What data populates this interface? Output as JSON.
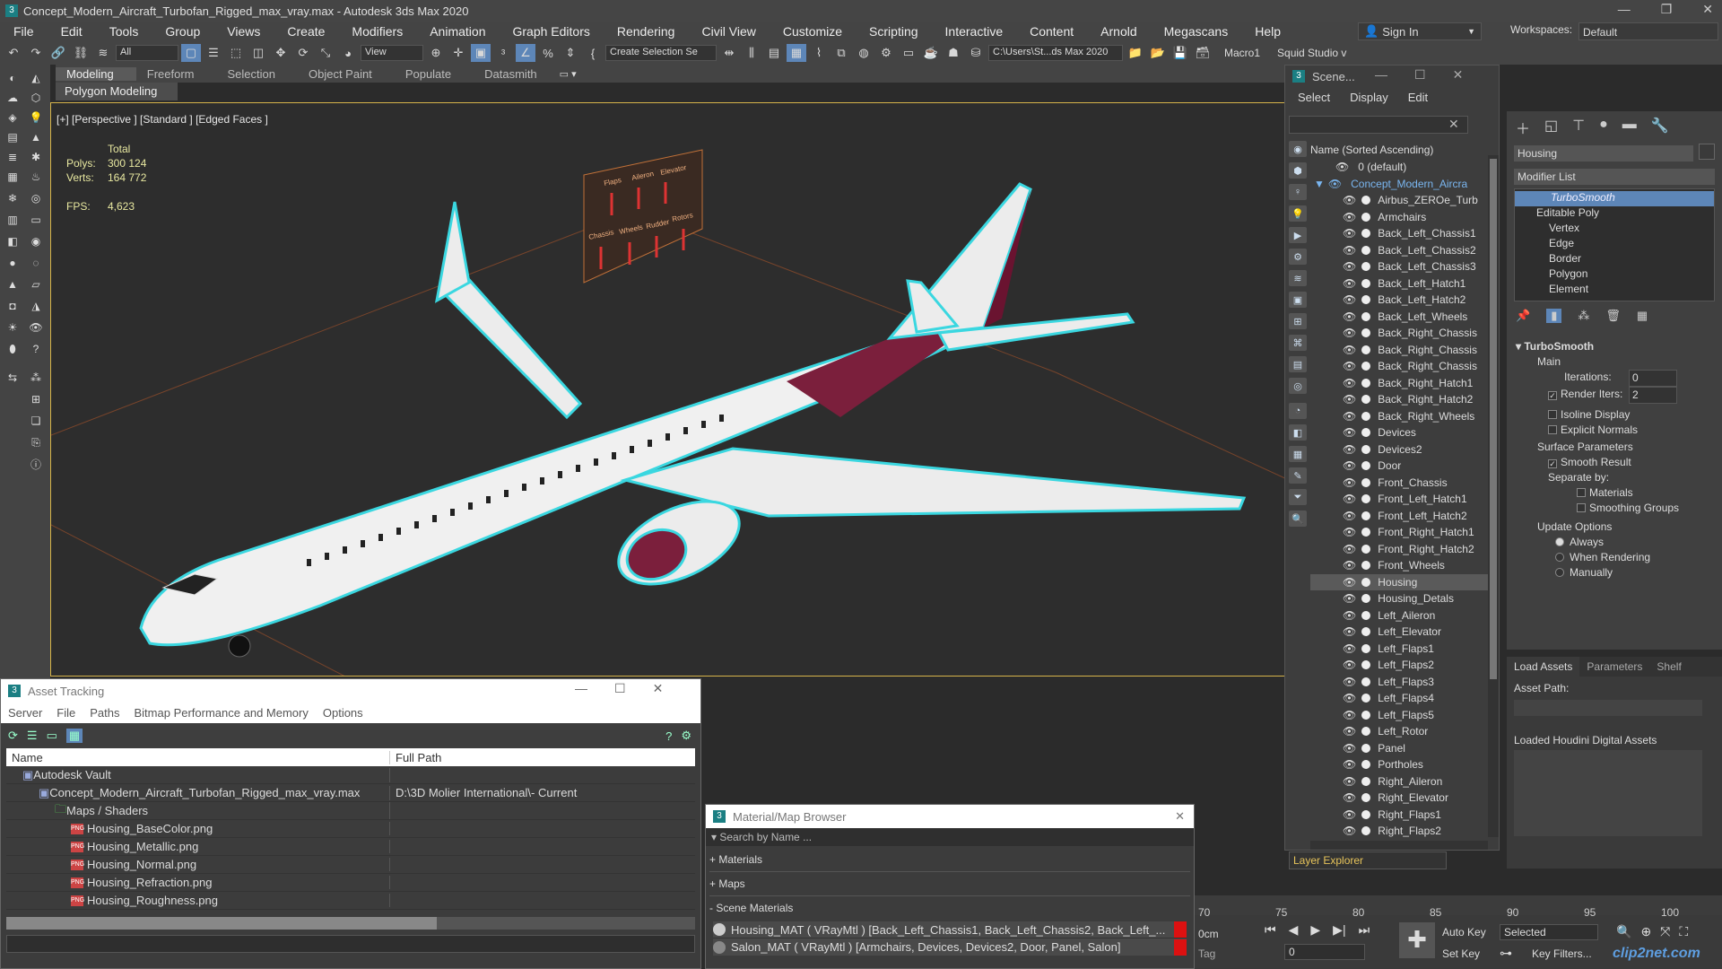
{
  "titlebar": {
    "title": "Concept_Modern_Aircraft_Turbofan_Rigged_max_vray.max - Autodesk 3ds Max 2020"
  },
  "menu": [
    "File",
    "Edit",
    "Tools",
    "Group",
    "Views",
    "Create",
    "Modifiers",
    "Animation",
    "Graph Editors",
    "Rendering",
    "Civil View",
    "Customize",
    "Scripting",
    "Interactive",
    "Content",
    "Arnold",
    "Megascans",
    "Help"
  ],
  "signin": "Sign In",
  "workspaces": {
    "label": "Workspaces:",
    "value": "Default"
  },
  "toolbar": {
    "filter": "All",
    "view": "View",
    "create_selection": "Create Selection Se",
    "path": "C:\\Users\\St...ds Max 2020",
    "macro": "Macro1",
    "squid": "Squid Studio v"
  },
  "ribbon": {
    "tabs": [
      "Modeling",
      "Freeform",
      "Selection",
      "Object Paint",
      "Populate",
      "Datasmith"
    ],
    "sub": "Polygon Modeling"
  },
  "viewport": {
    "label": "[+] [Perspective ] [Standard ] [Edged Faces ]",
    "stats": {
      "header": "Total",
      "polys_label": "Polys:",
      "polys": "300 124",
      "verts_label": "Verts:",
      "verts": "164 772",
      "fps_label": "FPS:",
      "fps": "4,623"
    },
    "rig_labels": [
      "Flaps",
      "Aileron",
      "Elevator",
      "Chassis",
      "Wheels",
      "Rudder",
      "Rotors"
    ]
  },
  "scene_explorer": {
    "title": "Scene...",
    "menu": [
      "Select",
      "Display",
      "Edit"
    ],
    "col_header": "Name (Sorted Ascending)",
    "default_layer": "0 (default)",
    "root": "Concept_Modern_Aircra",
    "items": [
      "Airbus_ZEROe_Turb",
      "Armchairs",
      "Back_Left_Chassis1",
      "Back_Left_Chassis2",
      "Back_Left_Chassis3",
      "Back_Left_Hatch1",
      "Back_Left_Hatch2",
      "Back_Left_Wheels",
      "Back_Right_Chassis",
      "Back_Right_Chassis",
      "Back_Right_Chassis",
      "Back_Right_Hatch1",
      "Back_Right_Hatch2",
      "Back_Right_Wheels",
      "Devices",
      "Devices2",
      "Door",
      "Front_Chassis",
      "Front_Left_Hatch1",
      "Front_Left_Hatch2",
      "Front_Right_Hatch1",
      "Front_Right_Hatch2",
      "Front_Wheels",
      "Housing",
      "Housing_Detals",
      "Left_Aileron",
      "Left_Elevator",
      "Left_Flaps1",
      "Left_Flaps2",
      "Left_Flaps3",
      "Left_Flaps4",
      "Left_Flaps5",
      "Left_Rotor",
      "Panel",
      "Portholes",
      "Right_Aileron",
      "Right_Elevator",
      "Right_Flaps1",
      "Right_Flaps2"
    ],
    "selected": "Housing",
    "footer": "Layer Explorer"
  },
  "command_panel": {
    "object_name": "Housing",
    "modifier_list": "Modifier List",
    "stack": [
      "TurboSmooth",
      "Editable Poly",
      "Vertex",
      "Edge",
      "Border",
      "Polygon",
      "Element"
    ],
    "turbosmooth": {
      "title": "TurboSmooth",
      "main": "Main",
      "iterations_label": "Iterations:",
      "iterations": "0",
      "render_iters_label": "Render Iters:",
      "render_iters": "2",
      "isoline": "Isoline Display",
      "explicit": "Explicit Normals",
      "surface": "Surface Parameters",
      "smooth_result": "Smooth Result",
      "separate_by": "Separate by:",
      "materials": "Materials",
      "smoothing_groups": "Smoothing Groups",
      "update_options": "Update Options",
      "always": "Always",
      "when_rendering": "When Rendering",
      "manually": "Manually"
    }
  },
  "houdini": {
    "tabs": [
      "Load Assets",
      "Parameters",
      "Shelf"
    ],
    "asset_path": "Asset Path:",
    "loaded": "Loaded Houdini Digital Assets"
  },
  "asset_tracking": {
    "title": "Asset Tracking",
    "menu": [
      "Server",
      "File",
      "Paths",
      "Bitmap Performance and Memory",
      "Options"
    ],
    "col_name": "Name",
    "col_path": "Full Path",
    "rows": [
      {
        "name": "Autodesk Vault",
        "path": "",
        "indent": 1
      },
      {
        "name": "Concept_Modern_Aircraft_Turbofan_Rigged_max_vray.max",
        "path": "D:\\3D Molier International\\- Current",
        "indent": 2
      },
      {
        "name": "Maps / Shaders",
        "path": "",
        "indent": 3
      },
      {
        "name": "Housing_BaseColor.png",
        "path": "",
        "indent": 4
      },
      {
        "name": "Housing_Metallic.png",
        "path": "",
        "indent": 4
      },
      {
        "name": "Housing_Normal.png",
        "path": "",
        "indent": 4
      },
      {
        "name": "Housing_Refraction.png",
        "path": "",
        "indent": 4
      },
      {
        "name": "Housing_Roughness.png",
        "path": "",
        "indent": 4
      }
    ]
  },
  "material_browser": {
    "title": "Material/Map Browser",
    "search": "Search by Name ...",
    "sections": [
      "+ Materials",
      "+ Maps",
      "- Scene Materials"
    ],
    "materials": [
      "Housing_MAT ( VRayMtl ) [Back_Left_Chassis1, Back_Left_Chassis2, Back_Left_...",
      "Salon_MAT ( VRayMtl ) [Armchairs, Devices, Devices2, Door, Panel, Salon]"
    ]
  },
  "timeline": {
    "ticks": [
      "70",
      "75",
      "80",
      "85",
      "90",
      "95",
      "100"
    ],
    "cm": "0cm",
    "tag": "Tag",
    "frame": "0",
    "auto_key": "Auto Key",
    "set_key": "Set Key",
    "selected": "Selected",
    "key_filters": "Key Filters...",
    "watermark": "clip2net.com"
  },
  "colors": {
    "accent": "#5d86b8",
    "selection_cyan": "#3ad7e0",
    "livery": "#7b1f3c",
    "viewport_border": "#d6b44a"
  }
}
